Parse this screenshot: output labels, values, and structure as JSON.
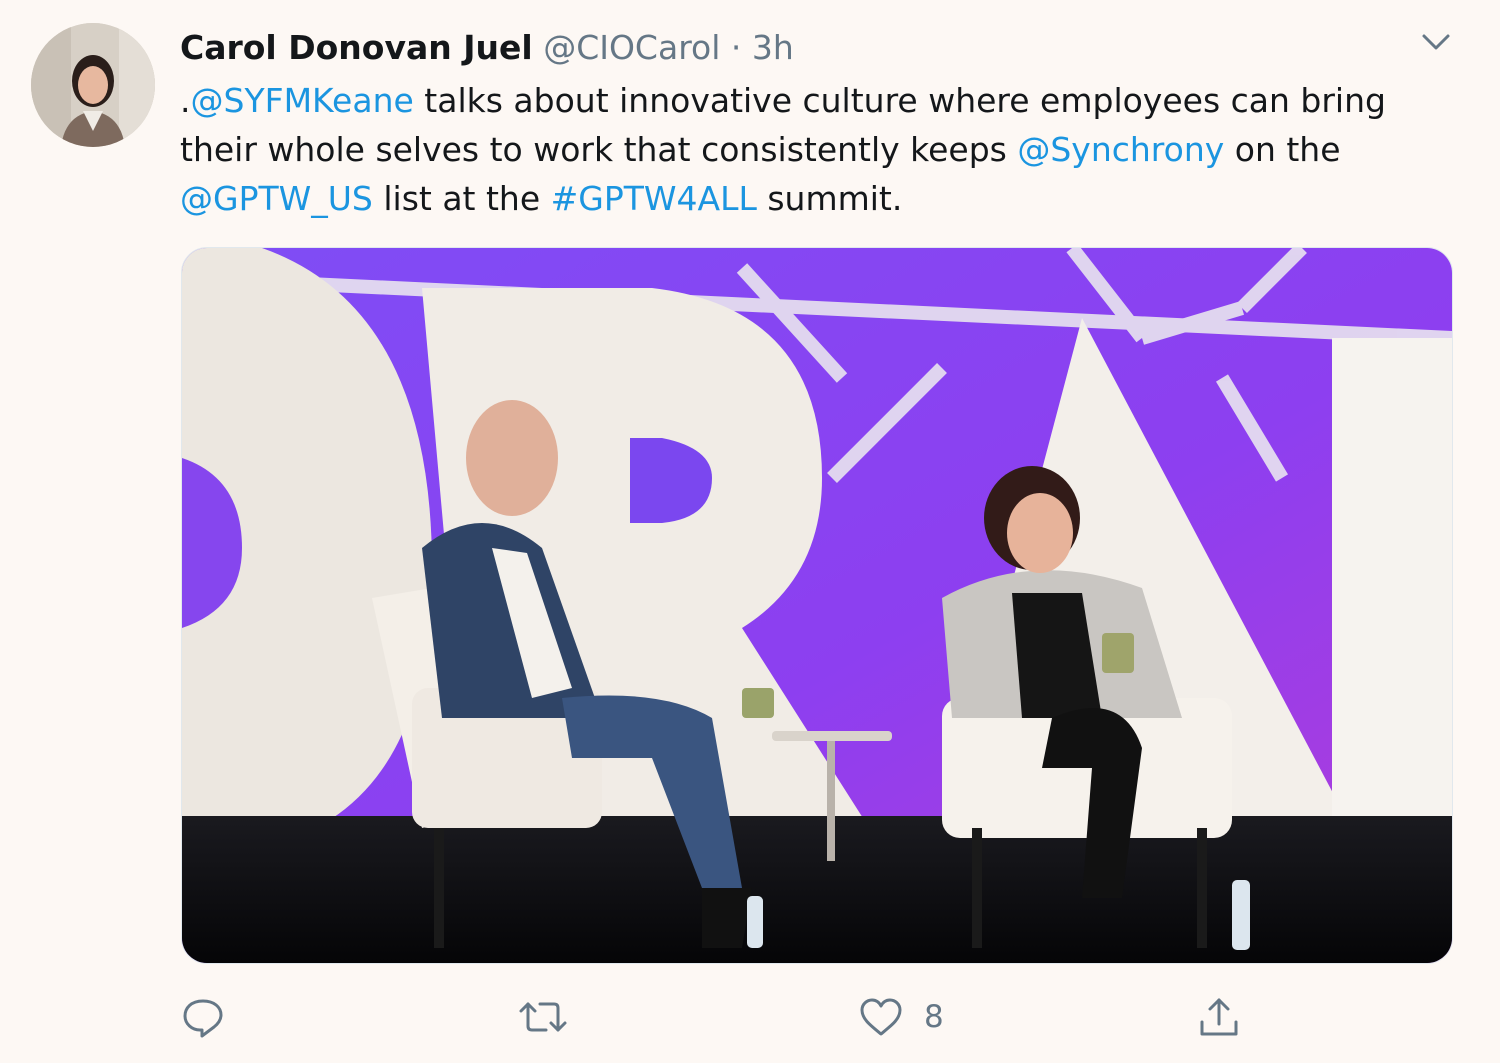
{
  "tweet": {
    "author_name": "Carol Donovan Juel",
    "handle": "@CIOCarol",
    "separator": "·",
    "time": "3h",
    "text_parts": [
      {
        "text": ".",
        "type": "plain"
      },
      {
        "text": "@SYFMKeane",
        "type": "mention"
      },
      {
        "text": " talks about innovative culture where employees can bring their whole selves to work that consistently keeps ",
        "type": "plain"
      },
      {
        "text": "@Synchrony",
        "type": "mention"
      },
      {
        "text": " on the ",
        "type": "plain"
      },
      {
        "text": "@GPTW_US",
        "type": "mention"
      },
      {
        "text": " list at the ",
        "type": "plain"
      },
      {
        "text": "#GPTW4ALL",
        "type": "hashtag"
      },
      {
        "text": " summit.",
        "type": "plain"
      }
    ],
    "actions": {
      "reply_icon": "reply-icon",
      "retweet_icon": "retweet-icon",
      "like_icon": "heart-icon",
      "like_count": "8",
      "share_icon": "share-icon"
    }
  },
  "colors": {
    "background": "#fdf8f4",
    "link": "#1b95e0",
    "secondary_text": "#657786",
    "stage_purple": "#8a3cf0"
  }
}
